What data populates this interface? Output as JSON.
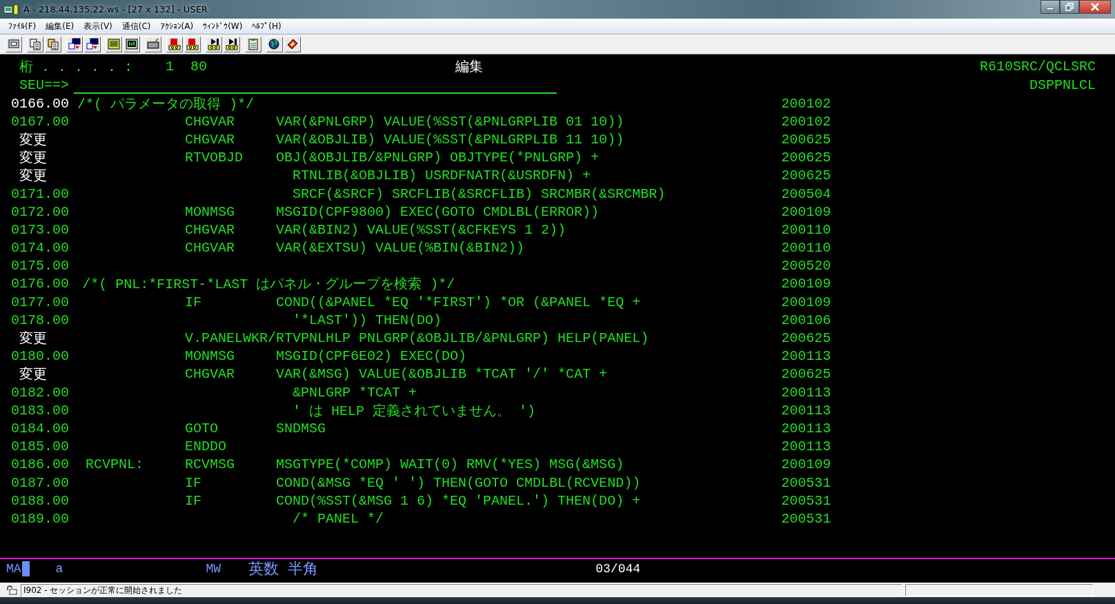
{
  "window": {
    "title": "A - 218.44.135.22.ws - [27 x 132] - USER"
  },
  "menu": [
    "ﾌｧｲﾙ(F)",
    "編集(E)",
    "表示(V)",
    "通信(C)",
    "ｱｸｼｮﾝ(A)",
    "ｳｨﾝﾄﾞｳ(W)",
    "ﾍﾙﾌﾟ(H)"
  ],
  "header": {
    "columns_label": "桁 . . . . . :",
    "columns_value": "1  80",
    "mode": "編集",
    "source_file": "R610SRC/QCLSRC",
    "member": "DSPPNLCL",
    "command_prompt": "SEU==>"
  },
  "lines": [
    {
      "seq": "0166.00",
      "current": true,
      "changed": false,
      "comment": "/*( パラメータの取得 )*/",
      "date": "200102"
    },
    {
      "seq": "0167.00",
      "current": false,
      "changed": false,
      "command": "CHGVAR",
      "params": "VAR(&PNLGRP) VALUE(%SST(&PNLGRPLIB 01 10))",
      "date": "200102"
    },
    {
      "seq": "変更",
      "current": false,
      "changed": true,
      "command": "CHGVAR",
      "params": "VAR(&OBJLIB) VALUE(%SST(&PNLGRPLIB 11 10))",
      "date": "200625"
    },
    {
      "seq": "変更",
      "current": false,
      "changed": true,
      "command": "RTVOBJD",
      "params": "OBJ(&OBJLIB/&PNLGRP) OBJTYPE(*PNLGRP) +",
      "date": "200625"
    },
    {
      "seq": "変更",
      "current": false,
      "changed": true,
      "continued": "RTNLIB(&OBJLIB) USRDFNATR(&USRDFN) +",
      "date": "200625"
    },
    {
      "seq": "0171.00",
      "current": false,
      "changed": false,
      "continued": "SRCF(&SRCF) SRCFLIB(&SRCFLIB) SRCMBR(&SRCMBR)",
      "date": "200504"
    },
    {
      "seq": "0172.00",
      "current": false,
      "changed": false,
      "command": "MONMSG",
      "params": "MSGID(CPF9800) EXEC(GOTO CMDLBL(ERROR))",
      "date": "200109"
    },
    {
      "seq": "0173.00",
      "current": false,
      "changed": false,
      "command": "CHGVAR",
      "params": "VAR(&BIN2) VALUE(%SST(&CFKEYS 1 2))",
      "date": "200110"
    },
    {
      "seq": "0174.00",
      "current": false,
      "changed": false,
      "command": "CHGVAR",
      "params": "VAR(&EXTSU) VALUE(%BIN(&BIN2))",
      "date": "200110"
    },
    {
      "seq": "0175.00",
      "current": false,
      "changed": false,
      "date": "200520"
    },
    {
      "seq": "0176.00",
      "current": false,
      "changed": false,
      "comment": "/*( PNL:*FIRST-*LAST はパネル・グループを検索 )*/",
      "date": "200109"
    },
    {
      "seq": "0177.00",
      "current": false,
      "changed": false,
      "command": "IF",
      "params": "COND((&PANEL *EQ '*FIRST') *OR (&PANEL *EQ +",
      "date": "200109"
    },
    {
      "seq": "0178.00",
      "current": false,
      "changed": false,
      "continued": "'*LAST')) THEN(DO)",
      "date": "200106"
    },
    {
      "seq": "変更",
      "current": false,
      "changed": true,
      "command": "V.PANELWKR/RTVPNLHLP PNLGRP(&OBJLIB/&PNLGRP) HELP(PANEL)",
      "date": "200625"
    },
    {
      "seq": "0180.00",
      "current": false,
      "changed": false,
      "command": "MONMSG",
      "params": "MSGID(CPF6E02) EXEC(DO)",
      "date": "200113"
    },
    {
      "seq": "変更",
      "current": false,
      "changed": true,
      "command": "CHGVAR",
      "params": "VAR(&MSG) VALUE(&OBJLIB *TCAT '/' *CAT +",
      "date": "200625"
    },
    {
      "seq": "0182.00",
      "current": false,
      "changed": false,
      "continued": "&PNLGRP *TCAT +",
      "date": "200113"
    },
    {
      "seq": "0183.00",
      "current": false,
      "changed": false,
      "continued": "' は HELP 定義されていません。 ')",
      "date": "200113"
    },
    {
      "seq": "0184.00",
      "current": false,
      "changed": false,
      "command": "GOTO",
      "params": "SNDMSG",
      "date": "200113"
    },
    {
      "seq": "0185.00",
      "current": false,
      "changed": false,
      "command": "ENDDO",
      "date": "200113"
    },
    {
      "seq": "0186.00",
      "current": false,
      "changed": false,
      "label": "RCVPNL:",
      "command": "RCVMSG",
      "params": "MSGTYPE(*COMP) WAIT(0) RMV(*YES) MSG(&MSG)",
      "date": "200109"
    },
    {
      "seq": "0187.00",
      "current": false,
      "changed": false,
      "command": "IF",
      "params": "COND(&MSG *EQ ' ') THEN(GOTO CMDLBL(RCVEND))",
      "date": "200531"
    },
    {
      "seq": "0188.00",
      "current": false,
      "changed": false,
      "command": "IF",
      "params": "COND(%SST(&MSG 1 6) *EQ 'PANEL.') THEN(DO) +",
      "date": "200531"
    },
    {
      "seq": "0189.00",
      "current": false,
      "changed": false,
      "continued": "/* PANEL */",
      "date": "200531"
    }
  ],
  "oia": {
    "mode": "MA",
    "shift": "a",
    "input": "MW",
    "ime": "英数 半角",
    "cursor_position": "03/044"
  },
  "status_bar": {
    "message": "I902 - セッションが正常に開始されました"
  }
}
